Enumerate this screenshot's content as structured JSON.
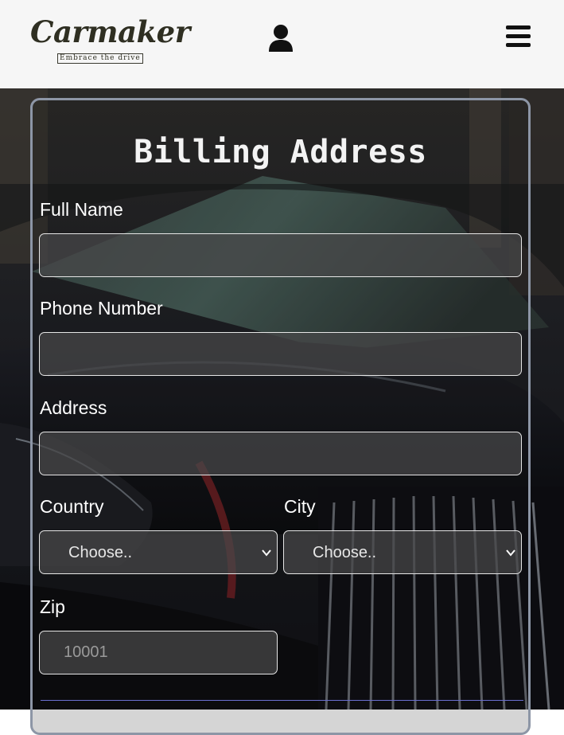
{
  "header": {
    "logo_title": "Carmaker",
    "logo_tagline": "Embrace the drive",
    "user_icon": "user-icon",
    "menu_icon": "hamburger-menu-icon"
  },
  "form": {
    "title": "Billing Address",
    "full_name": {
      "label": "Full Name",
      "value": "",
      "placeholder": ""
    },
    "phone": {
      "label": "Phone Number",
      "value": "",
      "placeholder": ""
    },
    "address": {
      "label": "Address",
      "value": "",
      "placeholder": ""
    },
    "country": {
      "label": "Country",
      "selected": "Choose.."
    },
    "city": {
      "label": "City",
      "selected": "Choose.."
    },
    "zip": {
      "label": "Zip",
      "value": "",
      "placeholder": "10001"
    }
  },
  "colors": {
    "header_bg": "#f6f6f6",
    "card_border": "#8d96a6",
    "field_bg": "#48484a",
    "divider": "#6a6fd0"
  }
}
